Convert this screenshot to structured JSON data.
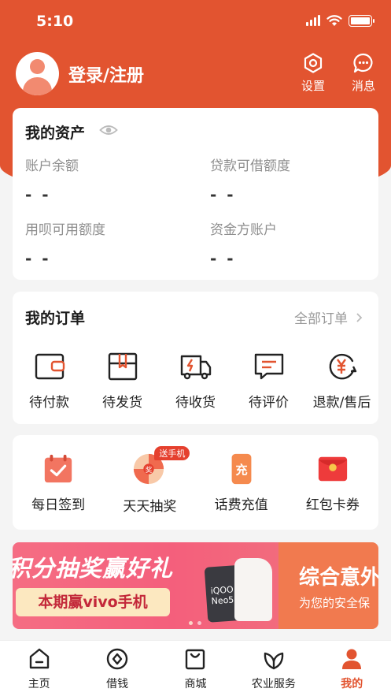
{
  "status_bar": {
    "time": "5:10"
  },
  "profile": {
    "login_label": "登录/注册"
  },
  "header": {
    "settings_label": "设置",
    "messages_label": "消息"
  },
  "assets": {
    "title": "我的资产",
    "items": [
      {
        "label": "账户余额",
        "value": "- -"
      },
      {
        "label": "贷款可借额度",
        "value": "- -"
      },
      {
        "label": "用呗可用额度",
        "value": "- -"
      },
      {
        "label": "资金方账户",
        "value": "- -"
      }
    ]
  },
  "orders": {
    "title": "我的订单",
    "all_label": "全部订单",
    "items": [
      {
        "label": "待付款",
        "icon": "wallet-icon"
      },
      {
        "label": "待发货",
        "icon": "package-icon"
      },
      {
        "label": "待收货",
        "icon": "truck-icon"
      },
      {
        "label": "待评价",
        "icon": "comment-icon"
      },
      {
        "label": "退款/售后",
        "icon": "refund-icon"
      }
    ]
  },
  "services": {
    "badge": "送手机",
    "items": [
      {
        "label": "每日签到",
        "icon": "calendar-check-icon"
      },
      {
        "label": "天天抽奖",
        "icon": "prize-wheel-icon"
      },
      {
        "label": "话费充值",
        "icon": "phone-recharge-icon"
      },
      {
        "label": "红包卡券",
        "icon": "red-envelope-icon"
      }
    ]
  },
  "banner": {
    "main_title": "积分抽奖赢好礼",
    "pill_text": "本期赢vivo手机",
    "phone_text": "iQOO Neo5",
    "side_title": "综合意外",
    "side_subtitle": "为您的安全保"
  },
  "tabbar": {
    "items": [
      {
        "label": "主页",
        "icon": "home-icon"
      },
      {
        "label": "借钱",
        "icon": "coin-icon"
      },
      {
        "label": "商城",
        "icon": "shopping-bag-icon"
      },
      {
        "label": "农业服务",
        "icon": "leaf-icon"
      },
      {
        "label": "我的",
        "icon": "user-icon",
        "active": true
      }
    ]
  },
  "colors": {
    "brand": "#e25430",
    "badge": "#e5402e",
    "icon_dark": "#222222"
  }
}
